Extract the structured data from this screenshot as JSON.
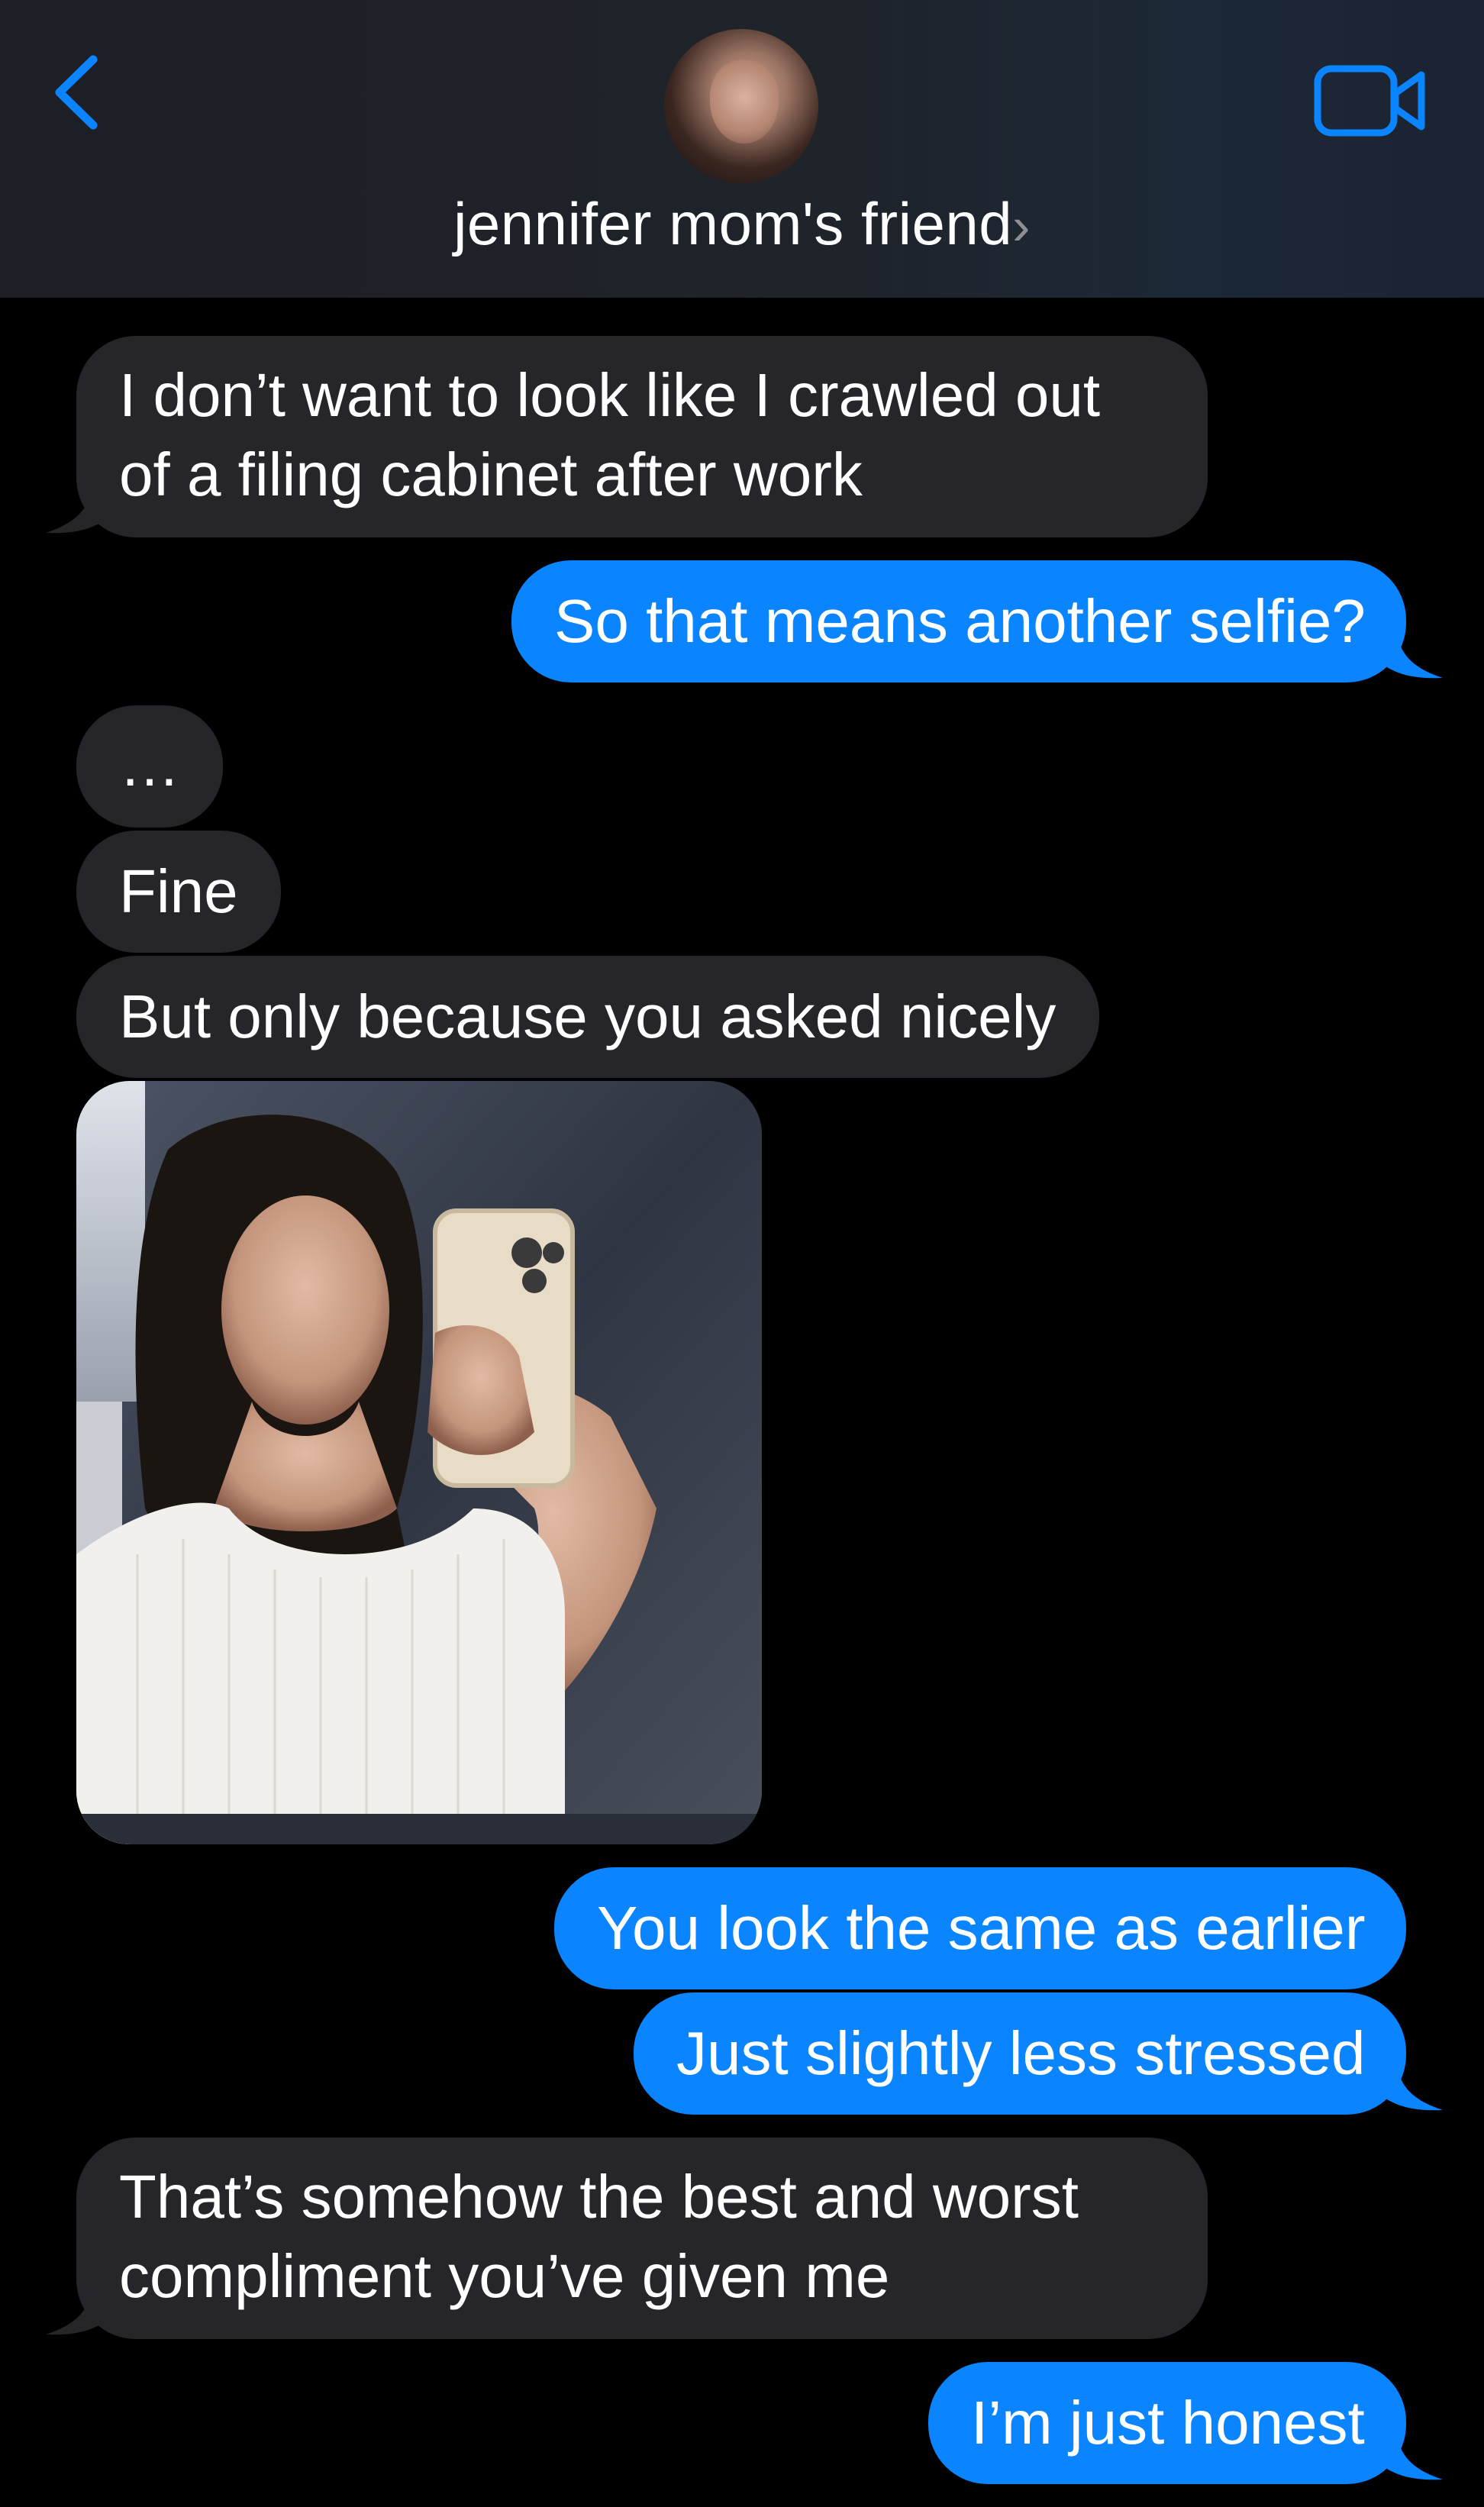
{
  "header": {
    "contact_name": "jennifer mom's friend",
    "chevron": "›",
    "back_icon": "chevron-left-icon",
    "video_icon": "video-camera-icon",
    "accent_color": "#0a84ff"
  },
  "messages": [
    {
      "from": "them",
      "lines": [
        "I don’t want to look like I crawled out",
        "of a filing cabinet after work"
      ]
    },
    {
      "from": "me",
      "lines": [
        "So that means another selfie?"
      ]
    },
    {
      "from": "them",
      "lines": [
        "…"
      ]
    },
    {
      "from": "them",
      "lines": [
        "Fine"
      ]
    },
    {
      "from": "them",
      "lines": [
        "But only because you asked nicely"
      ]
    },
    {
      "from": "them",
      "type": "photo"
    },
    {
      "from": "me",
      "lines": [
        "You look the same as earlier"
      ]
    },
    {
      "from": "me",
      "lines": [
        "Just slightly less stressed"
      ]
    },
    {
      "from": "them",
      "lines": [
        "That’s somehow the best and worst",
        "compliment you’ve given me"
      ]
    },
    {
      "from": "me",
      "lines": [
        "I’m just honest"
      ]
    }
  ],
  "colors": {
    "received_bubble": "#26252a",
    "sent_bubble": "#0a84ff",
    "background": "#000000"
  }
}
